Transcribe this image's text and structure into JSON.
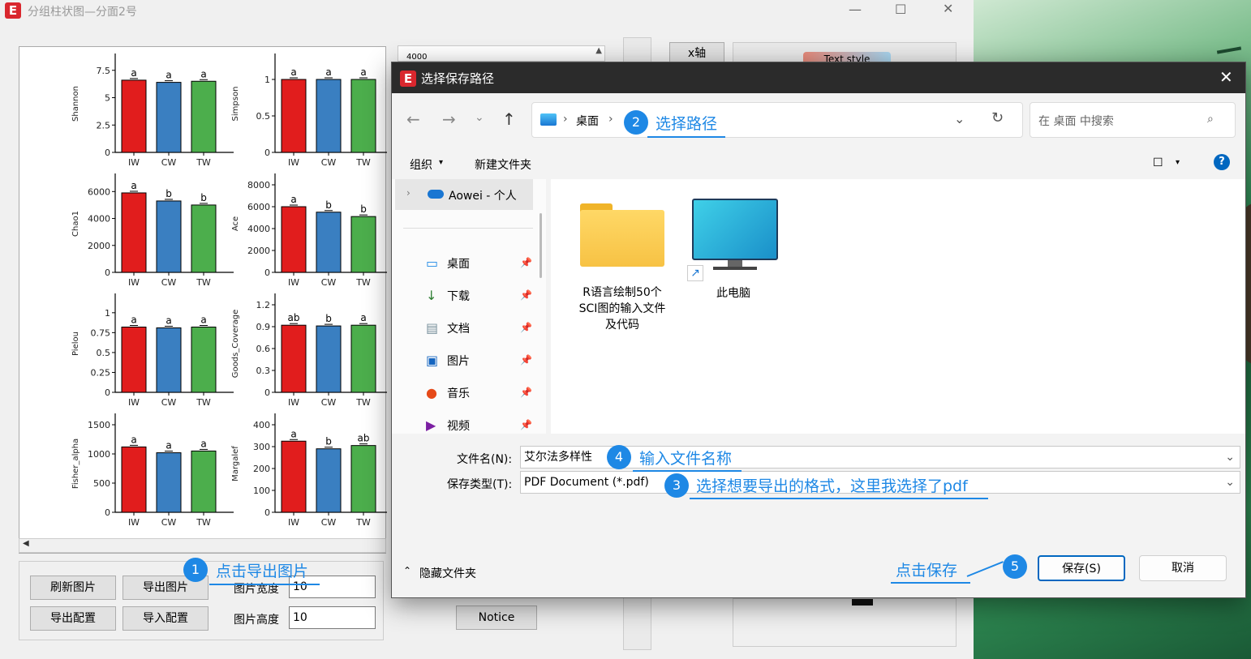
{
  "app": {
    "title": "分组柱状图—分面2号",
    "logo": "E",
    "scroll_value": "4000",
    "xaxis_tab": "x轴",
    "text_style_button": "Text style",
    "buttons": {
      "refresh": "刷新图片",
      "export_image": "导出图片",
      "export_config": "导出配置",
      "import_config": "导入配置",
      "notice": "Notice"
    },
    "width_label": "图片宽度",
    "width_value": "10",
    "height_label": "图片高度",
    "height_value": "10"
  },
  "chart_data": [
    {
      "type": "bar",
      "categories": [
        "IW",
        "CW",
        "TW"
      ],
      "values": [
        6.6,
        6.4,
        6.5
      ],
      "ylabel": "Shannon",
      "ylim": [
        0,
        8
      ],
      "yticks": [
        "0",
        "2.5",
        "5",
        "7.5"
      ],
      "letters": [
        "a",
        "a",
        "a"
      ]
    },
    {
      "type": "bar",
      "categories": [
        "IW",
        "CW",
        "TW"
      ],
      "values": [
        1.0,
        1.0,
        1.0
      ],
      "ylabel": "Simpson",
      "ylim": [
        0,
        1.2
      ],
      "yticks": [
        "0",
        "0.5",
        "1"
      ],
      "letters": [
        "a",
        "a",
        "a"
      ]
    },
    {
      "type": "bar",
      "categories": [
        "IW",
        "CW",
        "TW"
      ],
      "values": [
        5900,
        5300,
        5000
      ],
      "ylabel": "Chao1",
      "ylim": [
        0,
        6500
      ],
      "yticks": [
        "0",
        "2000",
        "4000",
        "6000"
      ],
      "letters": [
        "a",
        "b",
        "b"
      ]
    },
    {
      "type": "bar",
      "categories": [
        "IW",
        "CW",
        "TW"
      ],
      "values": [
        6000,
        5500,
        5100
      ],
      "ylabel": "Ace",
      "ylim": [
        0,
        8000
      ],
      "yticks": [
        "0",
        "2000",
        "4000",
        "6000",
        "8000"
      ],
      "letters": [
        "a",
        "b",
        "b"
      ]
    },
    {
      "type": "bar",
      "categories": [
        "IW",
        "CW",
        "TW"
      ],
      "values": [
        0.82,
        0.81,
        0.82
      ],
      "ylabel": "Pielou",
      "ylim": [
        0,
        1.1
      ],
      "yticks": [
        "0",
        "0.25",
        "0.5",
        "0.75",
        "1"
      ],
      "letters": [
        "a",
        "a",
        "a"
      ]
    },
    {
      "type": "bar",
      "categories": [
        "IW",
        "CW",
        "TW"
      ],
      "values": [
        0.92,
        0.91,
        0.92
      ],
      "ylabel": "Goods_Coverage",
      "ylim": [
        0,
        1.2
      ],
      "yticks": [
        "0",
        "0.3",
        "0.6",
        "0.9",
        "1.2"
      ],
      "letters": [
        "ab",
        "b",
        "a"
      ]
    },
    {
      "type": "bar",
      "categories": [
        "IW",
        "CW",
        "TW"
      ],
      "values": [
        1120,
        1020,
        1050
      ],
      "ylabel": "Fisher_alpha",
      "ylim": [
        0,
        1500
      ],
      "yticks": [
        "0",
        "500",
        "1000",
        "1500"
      ],
      "letters": [
        "a",
        "a",
        "a"
      ]
    },
    {
      "type": "bar",
      "categories": [
        "IW",
        "CW",
        "TW"
      ],
      "values": [
        325,
        290,
        305
      ],
      "ylabel": "Margalef",
      "ylim": [
        0,
        400
      ],
      "yticks": [
        "0",
        "100",
        "200",
        "300",
        "400"
      ],
      "letters": [
        "a",
        "b",
        "ab"
      ]
    }
  ],
  "chart_colors": [
    "#e11d1d",
    "#3a7fc1",
    "#4cae4c"
  ],
  "dialog": {
    "title": "选择保存路径",
    "breadcrumb": "桌面",
    "search_placeholder": "在 桌面 中搜索",
    "toolbar": {
      "organize": "组织",
      "new_folder": "新建文件夹"
    },
    "sidebar": {
      "cloud": "Aowei - 个人",
      "items": [
        {
          "label": "桌面",
          "icon": "desktop-icon"
        },
        {
          "label": "下载",
          "icon": "download-icon"
        },
        {
          "label": "文档",
          "icon": "document-icon"
        },
        {
          "label": "图片",
          "icon": "pictures-icon"
        },
        {
          "label": "音乐",
          "icon": "music-icon"
        },
        {
          "label": "视频",
          "icon": "video-icon"
        }
      ]
    },
    "files": [
      {
        "name": "R语言绘制50个SCI图的输入文件及代码",
        "line1": "R语言绘制50个",
        "line2": "SCI图的输入文件",
        "line3": "及代码",
        "icon": "folder-icon"
      },
      {
        "name": "此电脑",
        "icon": "computer-icon"
      }
    ],
    "filename_label": "文件名(N):",
    "filename_value": "艾尔法多样性",
    "filetype_label": "保存类型(T):",
    "filetype_value": "PDF Document (*.pdf)",
    "hide_folders": "隐藏文件夹",
    "save": "保存(S)",
    "cancel": "取消"
  },
  "annotations": [
    {
      "num": "1",
      "text": "点击导出图片"
    },
    {
      "num": "2",
      "text": "选择路径"
    },
    {
      "num": "3",
      "text": "选择想要导出的格式，这里我选择了pdf"
    },
    {
      "num": "4",
      "text": "输入文件名称"
    },
    {
      "num": "5",
      "text": "点击保存"
    }
  ]
}
